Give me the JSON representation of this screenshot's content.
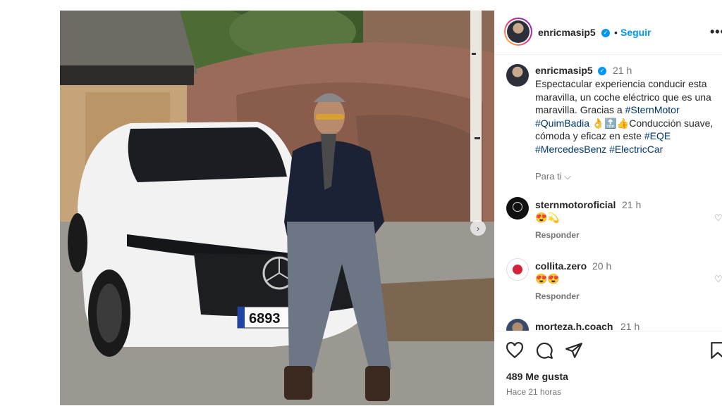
{
  "post": {
    "username": "enricmasip5",
    "follow_label": "Seguir",
    "separator": "•",
    "more_label": "•••",
    "caption": {
      "username": "enricmasip5",
      "time": "21 h",
      "text_parts": [
        {
          "text": "Espectacular experiencia conducir esta maravilla, un coche eléctrico que es una maravilla. Gracias a ",
          "tag": false
        },
        {
          "text": "#SternMotor",
          "tag": true
        },
        {
          "text": " ",
          "tag": false
        },
        {
          "text": "#QuimBadia",
          "tag": true
        },
        {
          "text": " 👌🔝👍Conducción suave, cómoda y eficaz en este ",
          "tag": false
        },
        {
          "text": "#EQE",
          "tag": true
        },
        {
          "text": " ",
          "tag": false
        },
        {
          "text": "#MercedesBenz",
          "tag": true
        },
        {
          "text": " ",
          "tag": false
        },
        {
          "text": "#ElectricCar",
          "tag": true
        }
      ],
      "translate_label": "Para ti ⌵"
    },
    "comments": [
      {
        "username": "sternmotoroficial",
        "time": "21 h",
        "text": "😍💫",
        "reply": "Responder",
        "avatar": "stern-logo"
      },
      {
        "username": "collita.zero",
        "time": "20 h",
        "text": "😍😍",
        "reply": "Responder",
        "avatar": "collita-logo"
      },
      {
        "username": "morteza.h.coach",
        "time": "21 h",
        "text": "",
        "reply": "",
        "avatar": "user-photo"
      }
    ],
    "likes": "489 Me gusta",
    "posted": "Hace 21 horas",
    "license_plate": "6893"
  },
  "icons": {
    "like": "heart-icon",
    "comment": "comment-icon",
    "share": "share-icon",
    "save": "bookmark-icon",
    "verified": "verified-badge-icon",
    "next": "chevron-right-icon"
  },
  "colors": {
    "link": "#0095f6",
    "hashtag": "#00376b",
    "muted": "#737373",
    "text": "#262626"
  }
}
